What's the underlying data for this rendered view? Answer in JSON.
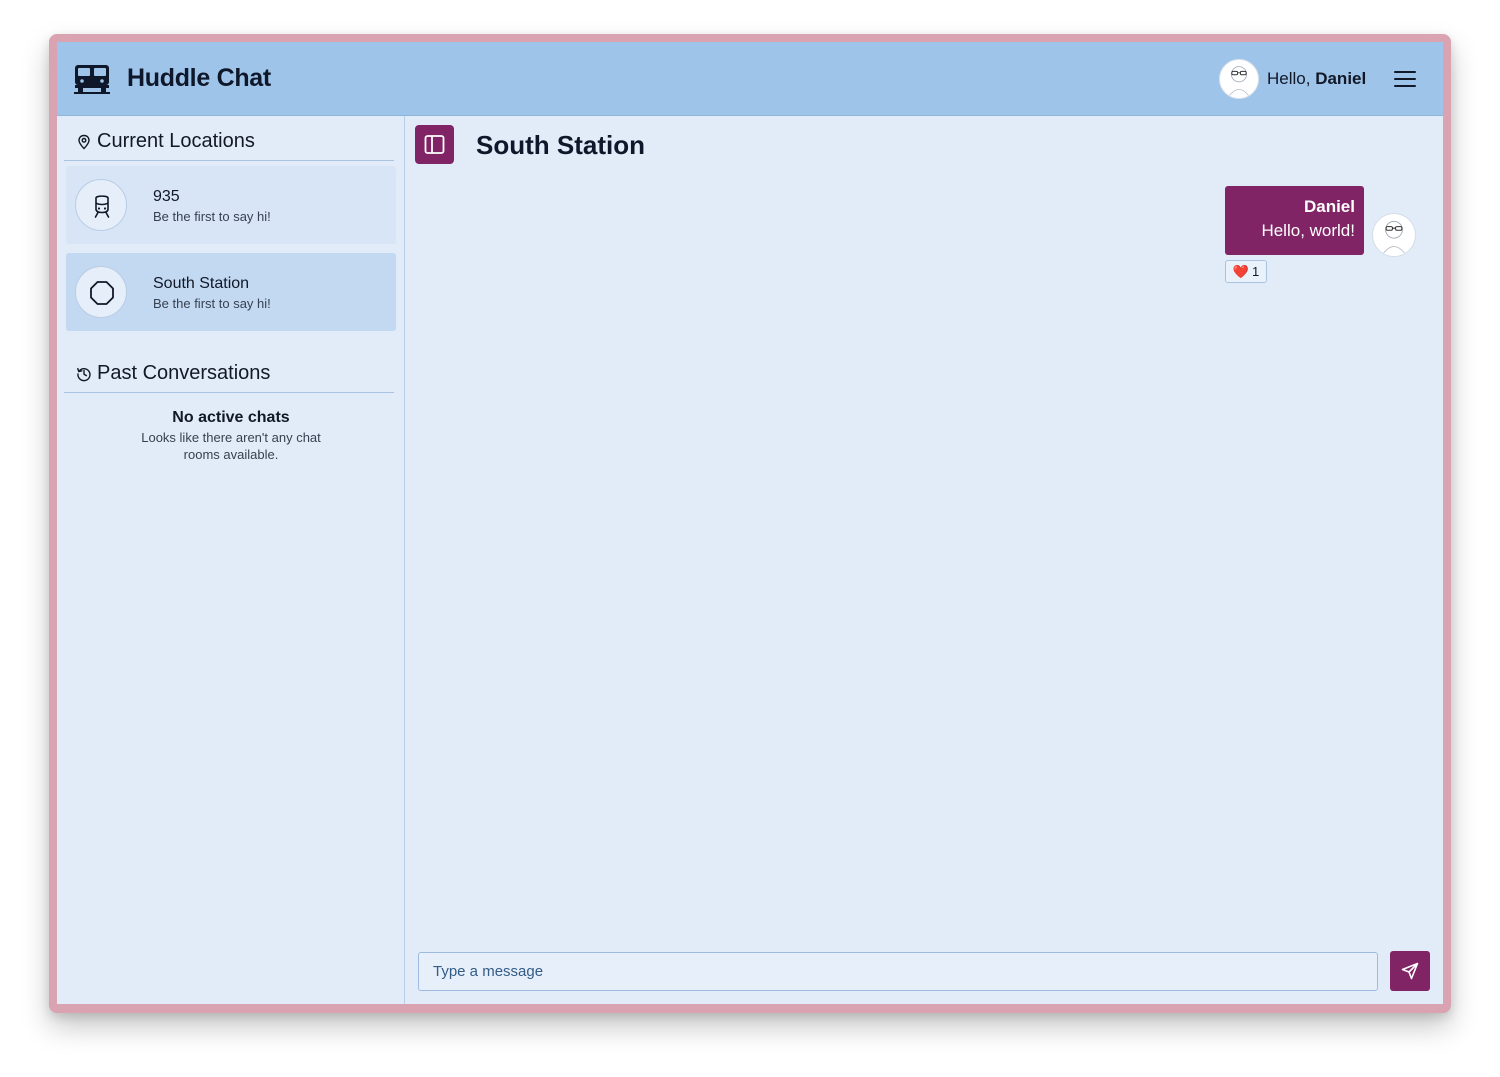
{
  "app": {
    "title": "Huddle Chat"
  },
  "header": {
    "greeting_prefix": "Hello,",
    "user_name": "Daniel"
  },
  "sidebar": {
    "current_locations": {
      "heading": "Current Locations",
      "items": [
        {
          "name": "935",
          "subtitle": "Be the first to say hi!",
          "icon": "train-icon",
          "active": false
        },
        {
          "name": "South Station",
          "subtitle": "Be the first to say hi!",
          "icon": "octagon-icon",
          "active": true
        }
      ]
    },
    "past_conversations": {
      "heading": "Past Conversations",
      "empty_title": "No active chats",
      "empty_subtitle": "Looks like there aren't any chat rooms available."
    }
  },
  "chat": {
    "room_title": "South Station",
    "messages": [
      {
        "author": "Daniel",
        "text": "Hello, world!",
        "reactions": [
          {
            "emoji": "❤️",
            "count": "1"
          }
        ]
      }
    ],
    "input": {
      "placeholder": "Type a message",
      "value": ""
    }
  },
  "colors": {
    "accent": "#802466",
    "header_bg": "#9fc4e9",
    "app_bg": "#e2ecf8",
    "frame": "#d9a3b1"
  }
}
